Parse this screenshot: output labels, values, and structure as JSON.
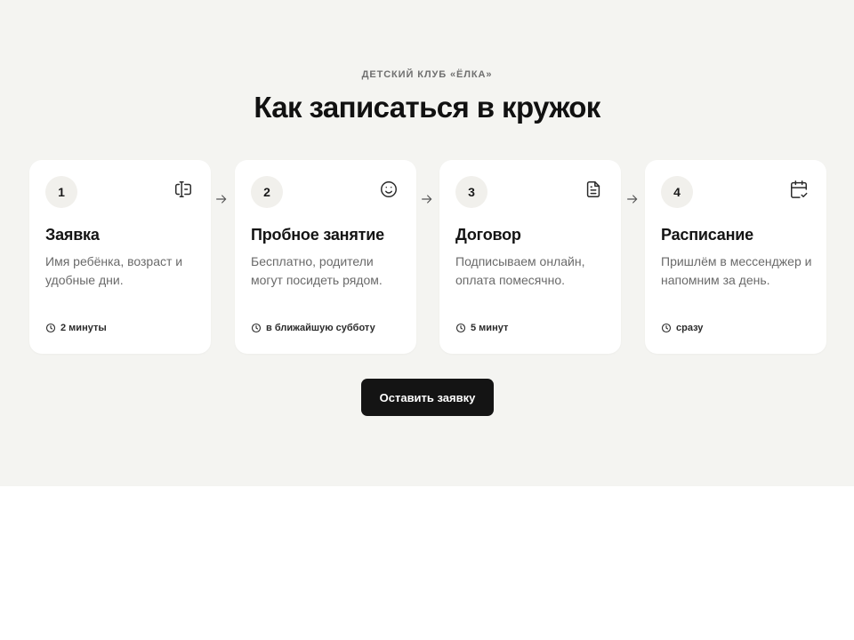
{
  "header": {
    "eyebrow": "ДЕТСКИЙ КЛУБ «ЁЛКА»",
    "title": "Как записаться в кружок"
  },
  "steps": [
    {
      "number": "1",
      "title": "Заявка",
      "description": "Имя ребёнка, возраст и удобные дни.",
      "meta": "2 минуты",
      "icon": "form-input-icon"
    },
    {
      "number": "2",
      "title": "Пробное занятие",
      "description": "Бесплатно, родители могут посидеть рядом.",
      "meta": "в ближайшую субботу",
      "icon": "smile-icon"
    },
    {
      "number": "3",
      "title": "Договор",
      "description": "Подписываем онлайн, оплата помесячно.",
      "meta": "5 минут",
      "icon": "document-icon"
    },
    {
      "number": "4",
      "title": "Расписание",
      "description": "Пришлём в мессенджер и напомним за день.",
      "meta": "сразу",
      "icon": "calendar-check-icon"
    }
  ],
  "cta": {
    "label": "Оставить заявку"
  },
  "colors": {
    "section_bg": "#f4f4f1",
    "card_bg": "#ffffff",
    "button_bg": "#141414",
    "text_primary": "#141414",
    "text_muted": "#6a6a6a"
  }
}
